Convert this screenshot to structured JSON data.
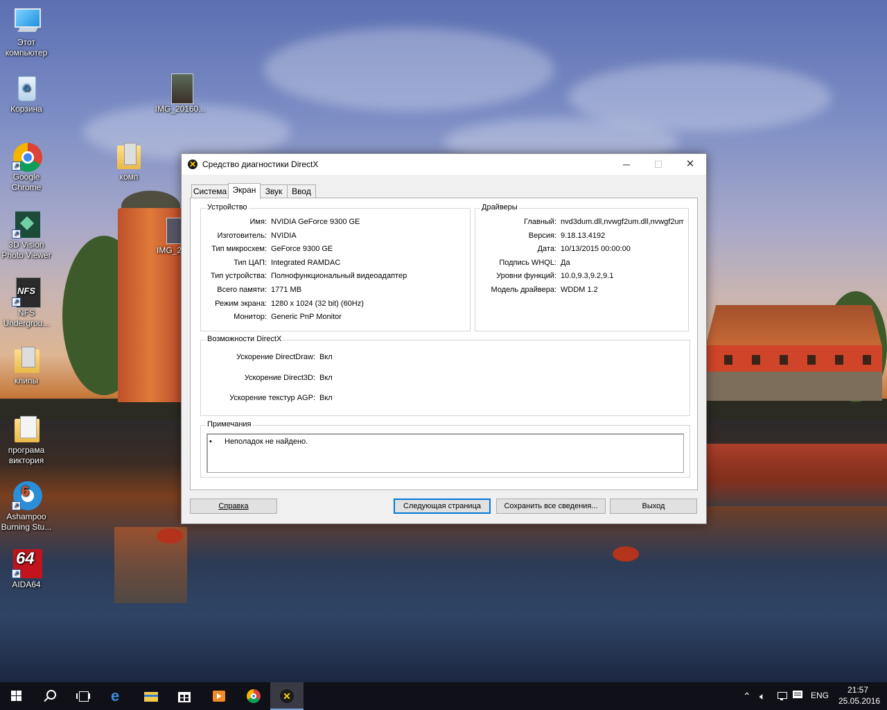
{
  "desktop": {
    "icons": [
      {
        "label": "Этот компьютер"
      },
      {
        "label": "Корзина"
      },
      {
        "label": "Google Chrome"
      },
      {
        "label": "3D Vision Photo Viewer"
      },
      {
        "label": "NFS Undergrou..."
      },
      {
        "label": "клипы"
      },
      {
        "label": "програма виктория"
      },
      {
        "label": "Ashampoo Burning Stu..."
      },
      {
        "label": "AIDA64"
      },
      {
        "label": "IMG_20160..."
      },
      {
        "label": "комп"
      },
      {
        "label": "IMG_2"
      }
    ],
    "nfs_logo_text": "NFS",
    "aida_logo_text": "64"
  },
  "window": {
    "title": "Средство диагностики DirectX",
    "controls": {
      "minimize": "─",
      "maximize": "☐",
      "close": "✕"
    },
    "tabs": [
      {
        "label": "Система"
      },
      {
        "label": "Экран"
      },
      {
        "label": "Звук"
      },
      {
        "label": "Ввод"
      }
    ],
    "device": {
      "heading": "Устройство",
      "rows": [
        {
          "label": "Имя:",
          "value": "NVIDIA GeForce 9300 GE"
        },
        {
          "label": "Изготовитель:",
          "value": "NVIDIA"
        },
        {
          "label": "Тип микросхем:",
          "value": "GeForce 9300 GE"
        },
        {
          "label": "Тип ЦАП:",
          "value": "Integrated RAMDAC"
        },
        {
          "label": "Тип устройства:",
          "value": "Полнофункциональный видеоадаптер"
        },
        {
          "label": "Всего памяти:",
          "value": "1771 MB"
        },
        {
          "label": "Режим экрана:",
          "value": "1280 x 1024 (32 bit) (60Hz)"
        },
        {
          "label": "Монитор:",
          "value": "Generic PnP Monitor"
        }
      ]
    },
    "drivers": {
      "heading": "Драйверы",
      "rows": [
        {
          "label": "Главный:",
          "value": "nvd3dum.dll,nvwgf2um.dll,nvwgf2um"
        },
        {
          "label": "Версия:",
          "value": "9.18.13.4192"
        },
        {
          "label": "Дата:",
          "value": "10/13/2015 00:00:00"
        },
        {
          "label": "Подпись WHQL:",
          "value": "Да"
        },
        {
          "label": "Уровни функций:",
          "value": "10.0,9.3,9.2,9.1"
        },
        {
          "label": "Модель драйвера:",
          "value": "WDDM 1.2"
        }
      ]
    },
    "features": {
      "heading": "Возможности DirectX",
      "rows": [
        {
          "label": "Ускорение DirectDraw:",
          "value": "Вкл"
        },
        {
          "label": "Ускорение Direct3D:",
          "value": "Вкл"
        },
        {
          "label": "Ускорение текстур AGP:",
          "value": "Вкл"
        }
      ]
    },
    "notes": {
      "heading": "Примечания",
      "bullet": "•",
      "items": [
        "Неполадок не найдено."
      ]
    },
    "buttons": {
      "help": "Справка",
      "next": "Следующая страница",
      "save": "Сохранить все сведения...",
      "exit": "Выход"
    }
  },
  "taskbar": {
    "lang": "ENG",
    "time": "21:57",
    "date": "25.05.2016",
    "tray_chevron": "⌃",
    "dxdiag_glyph": "✕"
  },
  "colors": {
    "accent": "#0078d7",
    "taskbar": "#101018",
    "dialog_bg": "#f0f0f0"
  }
}
